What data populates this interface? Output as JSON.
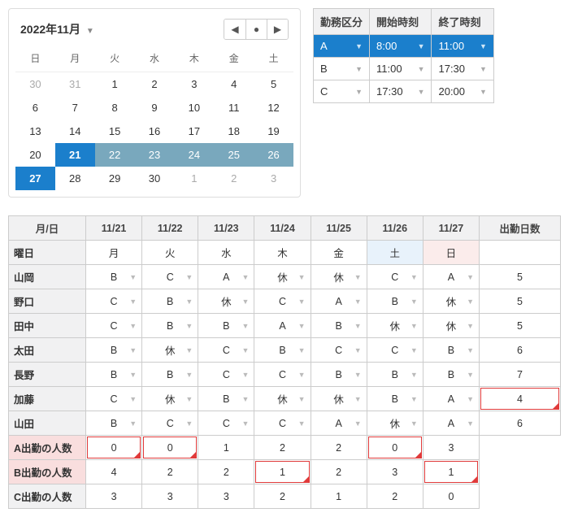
{
  "calendar": {
    "title": "2022年11月",
    "dow": [
      "日",
      "月",
      "火",
      "水",
      "木",
      "金",
      "土"
    ],
    "days": [
      {
        "n": "30",
        "cls": "other"
      },
      {
        "n": "31",
        "cls": "other"
      },
      {
        "n": "1"
      },
      {
        "n": "2"
      },
      {
        "n": "3"
      },
      {
        "n": "4"
      },
      {
        "n": "5"
      },
      {
        "n": "6"
      },
      {
        "n": "7"
      },
      {
        "n": "8"
      },
      {
        "n": "9"
      },
      {
        "n": "10"
      },
      {
        "n": "11"
      },
      {
        "n": "12"
      },
      {
        "n": "13"
      },
      {
        "n": "14"
      },
      {
        "n": "15"
      },
      {
        "n": "16"
      },
      {
        "n": "17"
      },
      {
        "n": "18"
      },
      {
        "n": "19"
      },
      {
        "n": "20"
      },
      {
        "n": "21",
        "cls": "sel"
      },
      {
        "n": "22",
        "cls": "range"
      },
      {
        "n": "23",
        "cls": "range"
      },
      {
        "n": "24",
        "cls": "range"
      },
      {
        "n": "25",
        "cls": "range"
      },
      {
        "n": "26",
        "cls": "range"
      },
      {
        "n": "27",
        "cls": "sel"
      },
      {
        "n": "28"
      },
      {
        "n": "29"
      },
      {
        "n": "30"
      },
      {
        "n": "1",
        "cls": "other"
      },
      {
        "n": "2",
        "cls": "other"
      },
      {
        "n": "3",
        "cls": "other"
      }
    ]
  },
  "shift": {
    "headers": [
      "勤務区分",
      "開始時刻",
      "終了時刻"
    ],
    "rows": [
      {
        "k": "A",
        "s": "8:00",
        "e": "11:00",
        "sel": true
      },
      {
        "k": "B",
        "s": "11:00",
        "e": "17:30"
      },
      {
        "k": "C",
        "s": "17:30",
        "e": "20:00"
      }
    ]
  },
  "schedule": {
    "col_header_label": "月/日",
    "dates": [
      "11/21",
      "11/22",
      "11/23",
      "11/24",
      "11/25",
      "11/26",
      "11/27"
    ],
    "dow_label": "曜日",
    "dow": [
      "月",
      "火",
      "水",
      "木",
      "金",
      "土",
      "日"
    ],
    "total_label": "出勤日数",
    "people": [
      {
        "name": "山岡",
        "v": [
          "B",
          "C",
          "A",
          "休",
          "休",
          "C",
          "A"
        ],
        "total": "5"
      },
      {
        "name": "野口",
        "v": [
          "C",
          "B",
          "休",
          "C",
          "A",
          "B",
          "休"
        ],
        "total": "5"
      },
      {
        "name": "田中",
        "v": [
          "C",
          "B",
          "B",
          "A",
          "B",
          "休",
          "休"
        ],
        "total": "5"
      },
      {
        "name": "太田",
        "v": [
          "B",
          "休",
          "C",
          "B",
          "C",
          "C",
          "B"
        ],
        "total": "6"
      },
      {
        "name": "長野",
        "v": [
          "B",
          "B",
          "C",
          "C",
          "B",
          "B",
          "B"
        ],
        "total": "7"
      },
      {
        "name": "加藤",
        "v": [
          "C",
          "休",
          "B",
          "休",
          "休",
          "B",
          "A"
        ],
        "total": "4",
        "flag_total": true
      },
      {
        "name": "山田",
        "v": [
          "B",
          "C",
          "C",
          "C",
          "A",
          "休",
          "A"
        ],
        "total": "6"
      }
    ],
    "summary": [
      {
        "label": "A出勤の人数",
        "v": [
          "0",
          "0",
          "1",
          "2",
          "2",
          "0",
          "3"
        ],
        "pink": true,
        "flags": [
          0,
          1,
          5
        ]
      },
      {
        "label": "B出勤の人数",
        "v": [
          "4",
          "2",
          "2",
          "1",
          "2",
          "3",
          "1"
        ],
        "pink": true,
        "flags": [
          3,
          6
        ]
      },
      {
        "label": "C出勤の人数",
        "v": [
          "3",
          "3",
          "3",
          "2",
          "1",
          "2",
          "0"
        ],
        "pink": false,
        "flags": []
      }
    ]
  }
}
